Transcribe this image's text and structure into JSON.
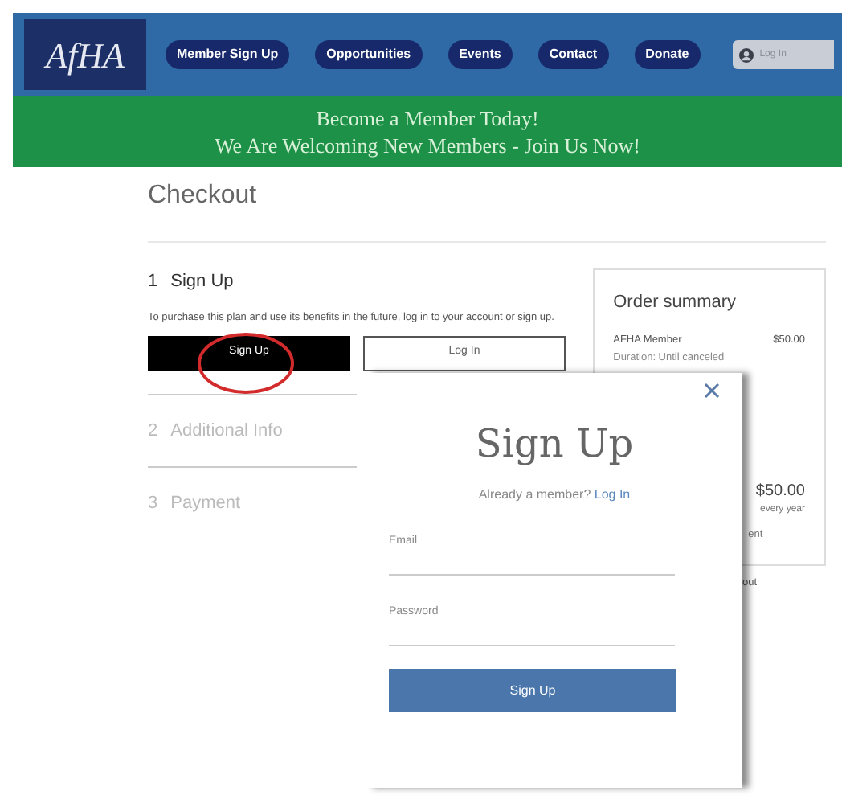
{
  "header": {
    "logo": "AfHA",
    "nav": [
      {
        "label": "Member Sign Up"
      },
      {
        "label": "Opportunities"
      },
      {
        "label": "Events"
      },
      {
        "label": "Contact"
      },
      {
        "label": "Donate"
      }
    ],
    "login": "Log In"
  },
  "banner": {
    "lines": [
      "Become a Member Today!",
      "We Are Welcoming New Members - Join Us Now!"
    ]
  },
  "checkout": {
    "title": "Checkout",
    "steps": [
      {
        "number": "1",
        "label": "Sign Up",
        "active": true,
        "text": "To purchase this plan and use its benefits in the future, log in to your account or sign up.",
        "buttons": [
          "Sign Up",
          "Log In"
        ]
      },
      {
        "number": "2",
        "label": "Additional Info",
        "active": false
      },
      {
        "number": "3",
        "label": "Payment",
        "active": false
      }
    ],
    "summary": {
      "title": "Order summary",
      "item": "AFHA Member",
      "price": "$50.00",
      "duration": "Duration: Until canceled",
      "total": "$50.00",
      "period": "every year",
      "fragment": "ent"
    },
    "below_fragment": "out"
  },
  "modal": {
    "title": "Sign Up",
    "prompt": "Already a member?",
    "link": "Log In",
    "fields": [
      {
        "label": "Email"
      },
      {
        "label": "Password"
      }
    ],
    "submit": "Sign Up"
  }
}
